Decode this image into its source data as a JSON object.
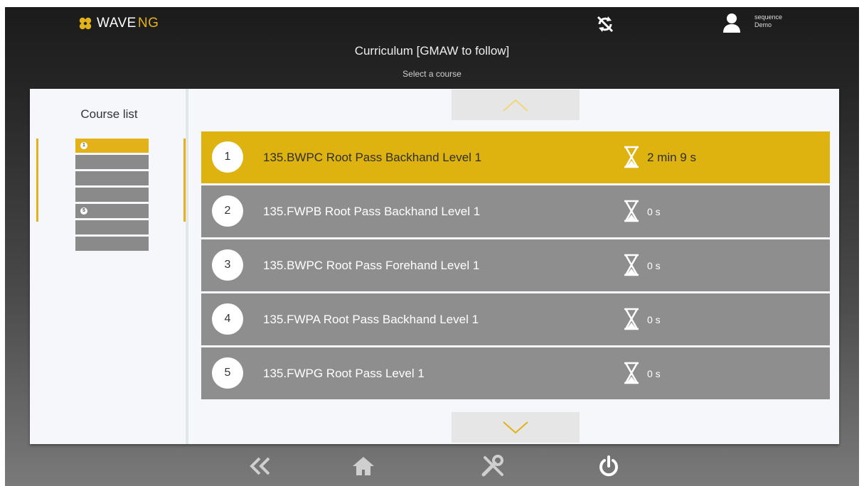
{
  "header": {
    "brand_wave": "WAVE",
    "brand_ng": "NG",
    "user_name": "sequence",
    "user_role": "Demo",
    "title": "Curriculum [GMAW to follow]",
    "subtitle": "Select a course"
  },
  "sidebar": {
    "title": "Course list",
    "items": [
      {
        "marker": "1",
        "active": true
      },
      {
        "marker": "",
        "active": false
      },
      {
        "marker": "",
        "active": false
      },
      {
        "marker": "",
        "active": false
      },
      {
        "marker": "5",
        "active": false
      },
      {
        "marker": "",
        "active": false
      },
      {
        "marker": "",
        "active": false
      }
    ]
  },
  "courses": [
    {
      "number": "1",
      "name": "135.BWPC Root Pass Backhand Level 1",
      "duration": "2 min 9 s",
      "active": true
    },
    {
      "number": "2",
      "name": "135.FWPB Root Pass Backhand Level 1",
      "duration": "0 s",
      "active": false
    },
    {
      "number": "3",
      "name": "135.BWPC Root Pass Forehand Level 1",
      "duration": "0 s",
      "active": false
    },
    {
      "number": "4",
      "name": "135.FWPA Root Pass Backhand Level 1",
      "duration": "0 s",
      "active": false
    },
    {
      "number": "5",
      "name": "135.FWPG Root Pass Level 1",
      "duration": "0 s",
      "active": false
    }
  ],
  "icons": {
    "logo": "flower-logo-icon",
    "sync": "sync-disabled-icon",
    "user": "user-icon",
    "scroll_up": "chevron-up-icon",
    "scroll_down": "chevron-down-icon",
    "back": "double-chevron-left-icon",
    "home": "home-icon",
    "tools": "tools-icon",
    "power": "power-icon",
    "timer": "hourglass-icon"
  },
  "colors": {
    "accent": "#deb30f",
    "row_inactive": "#8e8e8e",
    "panel": "#f5f7fa"
  }
}
